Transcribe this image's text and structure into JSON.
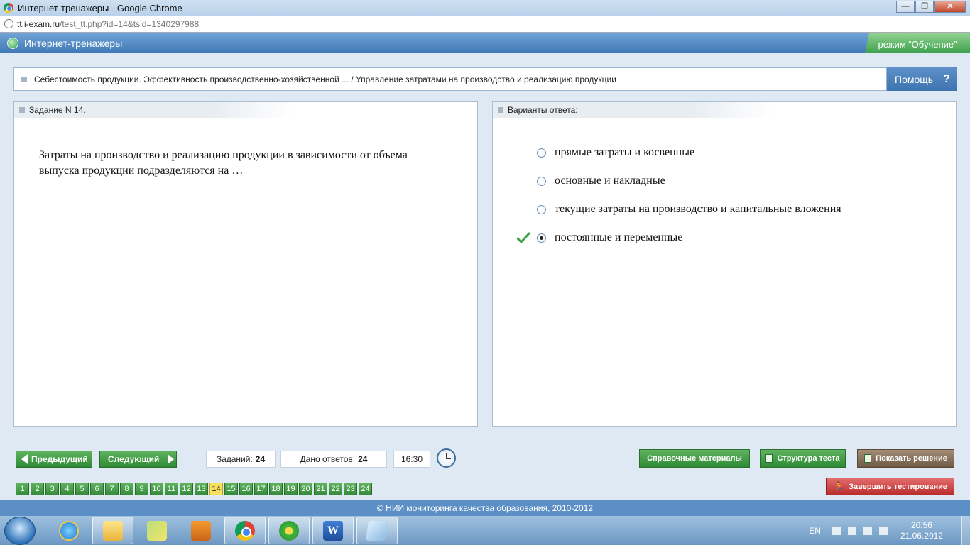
{
  "window": {
    "title": "Интернет-тренажеры - Google Chrome",
    "minimize_label": "—",
    "maximize_label": "❐",
    "close_label": "✕"
  },
  "address": {
    "host": "tt.i-exam.ru",
    "path": "/test_tt.php?id=14&tsid=1340297988"
  },
  "app": {
    "title": "Интернет-тренажеры",
    "mode": "режим “Обучение”"
  },
  "breadcrumb": "Себестоимость продукции. Эффективность производственно-хозяйственной ... / Управление затратами на производство и реализацию продукции",
  "help": {
    "label": "Помощь",
    "icon": "?"
  },
  "task": {
    "header": "Задание N 14.",
    "question": "Затраты на производство и реализацию продукции в зависимости от объема выпуска продукции подразделяются на …"
  },
  "answers": {
    "header": "Варианты ответа:",
    "options": [
      {
        "label": "прямые затраты и косвенные",
        "selected": false
      },
      {
        "label": "основные и накладные",
        "selected": false
      },
      {
        "label": "текущие затраты на производство и капитальные вложения",
        "selected": false
      },
      {
        "label": "постоянные и переменные",
        "selected": true
      }
    ]
  },
  "toolbar": {
    "prev": "Предыдущий",
    "next": "Следующий",
    "tasks_label": "Заданий:",
    "tasks_value": "24",
    "answered_label": "Дано ответов:",
    "answered_value": "24",
    "timer": "16:30",
    "reference": "Справочные материалы",
    "structure": "Структура теста",
    "show_solution": "Показать решение",
    "finish": "Завершить тестирование"
  },
  "pages": [
    "1",
    "2",
    "3",
    "4",
    "5",
    "6",
    "7",
    "8",
    "9",
    "10",
    "11",
    "12",
    "13",
    "14",
    "15",
    "16",
    "17",
    "18",
    "19",
    "20",
    "21",
    "22",
    "23",
    "24"
  ],
  "current_page": "14",
  "footer": "© НИИ мониторинга качества образования, 2010-2012",
  "taskbar": {
    "lang": "EN",
    "time": "20:56",
    "date": "21.06.2012"
  },
  "colors": {
    "accent_blue": "#4a86c1",
    "button_green": "#378c3b",
    "current_page_yellow": "#f7e05a",
    "finish_red": "#bb2d2d",
    "solution_brown": "#6f5a47"
  }
}
